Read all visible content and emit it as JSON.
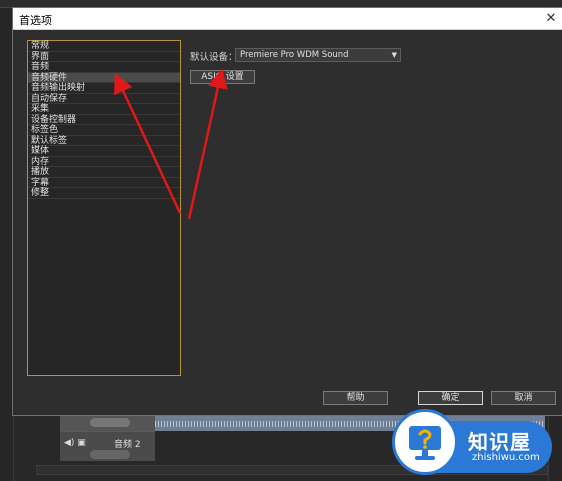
{
  "dialog": {
    "title": "首选项"
  },
  "categories": [
    "常规",
    "界面",
    "音频",
    "音频硬件",
    "音频输出映射",
    "自动保存",
    "采集",
    "设备控制器",
    "标签色",
    "默认标签",
    "媒体",
    "内存",
    "播放",
    "字幕",
    "修整"
  ],
  "selected_category": "音频硬件",
  "audio_hardware": {
    "device_label": "默认设备：",
    "device_value": "Premiere Pro WDM Sound",
    "asio_button": "ASIO 设置"
  },
  "buttons": {
    "help": "帮助",
    "ok": "确定",
    "cancel": "取消"
  },
  "background": {
    "track_name": "音频 2"
  },
  "watermark": {
    "brand": "知识屋",
    "url": "zhishiwu.com"
  },
  "colors": {
    "annotation_arrow": "#e01818",
    "list_border": "#b7913b",
    "watermark_blue": "#2b78d6"
  }
}
